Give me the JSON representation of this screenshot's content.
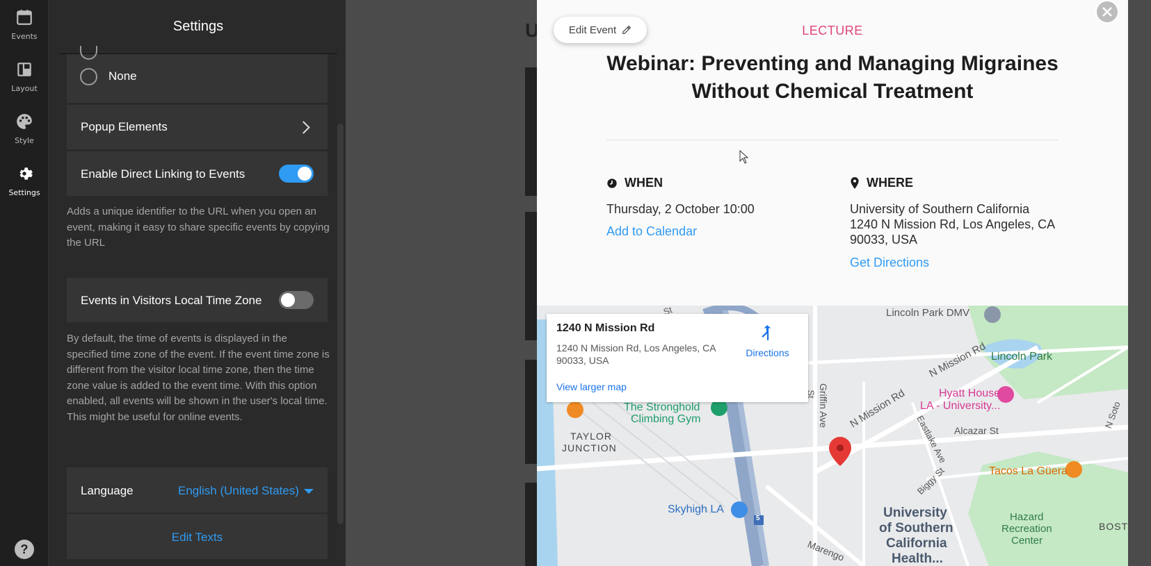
{
  "rail": {
    "items": [
      {
        "label": "Events",
        "icon": "calendar-icon"
      },
      {
        "label": "Layout",
        "icon": "layout-icon"
      },
      {
        "label": "Style",
        "icon": "palette-icon"
      },
      {
        "label": "Settings",
        "icon": "gear-icon"
      }
    ],
    "help_icon": "help-icon"
  },
  "settings": {
    "title": "Settings",
    "radio_none_label": "None",
    "popup_elements_label": "Popup Elements",
    "direct_linking": {
      "label": "Enable Direct Linking to Events",
      "enabled": true,
      "description": "Adds a unique identifier to the URL when you open an event, making it easy to share specific events by copying the URL"
    },
    "local_time_zone": {
      "label": "Events in Visitors Local Time Zone",
      "enabled": false,
      "description": "By default, the time of events is displayed in the specified time zone of the event. If the event time zone is different from the visitor local time zone, then the time zone value is added to the event time. With this option enabled, all events will be shown in the user's local time. This might be useful for online events."
    },
    "language": {
      "label": "Language",
      "value": "English (United States)"
    },
    "edit_texts_label": "Edit Texts"
  },
  "popup": {
    "edit_event_label": "Edit Event",
    "category": "LECTURE",
    "title": "Webinar: Preventing and Managing Migraines Without Chemical Treatment",
    "when": {
      "heading": "WHEN",
      "datetime": "Thursday, 2 October 10:00",
      "add_to_calendar": "Add to Calendar"
    },
    "where": {
      "heading": "WHERE",
      "venue": "University of Southern California",
      "address": "1240 N Mission Rd, Los Angeles, CA 90033, USA",
      "get_directions": "Get Directions"
    },
    "map": {
      "card_title": "1240 N Mission Rd",
      "card_address": "1240 N Mission Rd, Los Angeles, CA 90033, USA",
      "directions_label": "Directions",
      "view_larger": "View larger map",
      "labels": {
        "lincoln_park_dmv": "Lincoln Park DMV",
        "lincoln_park": "Lincoln Park",
        "n_mission_rd_1": "N Mission Rd",
        "n_mission_rd_2": "N Mission Rd",
        "hyatt_line1": "Hyatt House",
        "hyatt_line2": "LA - University...",
        "stronghold_line1": "The Stronghold",
        "stronghold_line2": "Climbing Gym",
        "taylor_line1": "TAYLOR",
        "taylor_line2": "JUNCTION",
        "griffin_ave": "Griffin Ave",
        "alcazar_st": "Alcazar St",
        "eastlake_ave": "Eastlake Ave",
        "tacos": "Tacos La Güera",
        "biggy_st": "Biggy St",
        "skyhigh": "Skyhigh LA",
        "usc_line1": "University",
        "usc_line2": "of Southern",
        "usc_line3": "California",
        "usc_line4": "Health...",
        "hazard_line1": "Hazard",
        "hazard_line2": "Recreation",
        "hazard_line3": "Center",
        "marengo": "Marengo",
        "bost": "BOST",
        "n_soto": "N Soto",
        "route_5": "5",
        "n_st": "St",
        "st_partial": "St"
      }
    }
  },
  "colors": {
    "accent_blue": "#2f9bf3",
    "category_pink": "#e0457b",
    "map_pin_red": "#e53935",
    "park_green": "#c5e8c5"
  }
}
